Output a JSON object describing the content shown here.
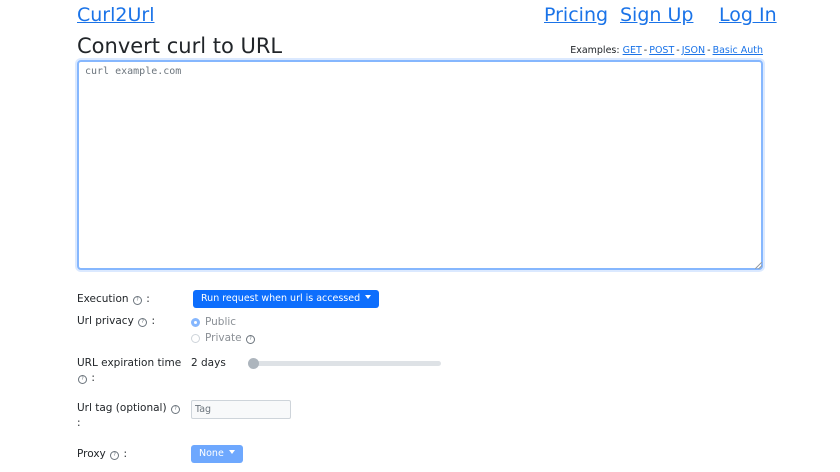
{
  "nav": {
    "brand": "Curl2Url",
    "pricing": "Pricing",
    "signup": "Sign Up",
    "login": "Log In"
  },
  "page": {
    "title": "Convert curl to URL"
  },
  "examples": {
    "label": "Examples:",
    "links": [
      "GET",
      "POST",
      "JSON",
      "Basic Auth"
    ],
    "separator": "-"
  },
  "curl_input": {
    "placeholder": "curl example.com",
    "value": ""
  },
  "form": {
    "info_glyph": "?",
    "execution": {
      "label": "Execution",
      "suffix": ":",
      "button_label": "Run request when url is accessed"
    },
    "privacy": {
      "label": "Url privacy",
      "suffix": ":",
      "options": [
        {
          "label": "Public",
          "checked": true
        },
        {
          "label": "Private",
          "checked": false
        }
      ]
    },
    "expiration": {
      "label": "URL expiration time",
      "suffix": ":",
      "value": "2 days",
      "slider_fraction": 0.0
    },
    "tag": {
      "label": "Url tag (optional)",
      "suffix": ":",
      "placeholder": "Tag"
    },
    "proxy": {
      "label": "Proxy",
      "suffix": ":",
      "button_label": "None"
    }
  },
  "colors": {
    "link": "#1a73e8",
    "primary": "#0d6efd",
    "focus_border": "#86b7fe"
  }
}
